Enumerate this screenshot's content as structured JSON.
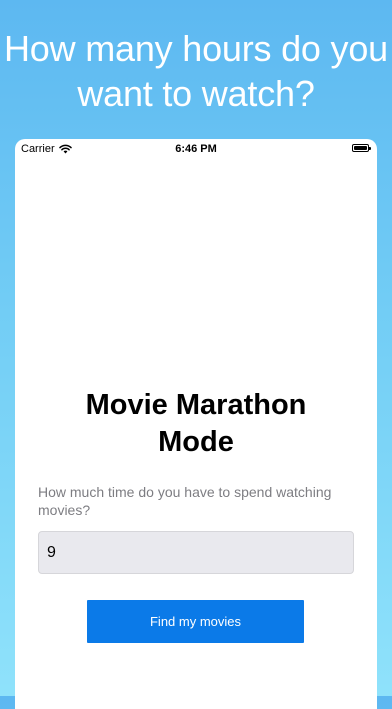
{
  "promo": {
    "headline_line1": "How many hours do you",
    "headline_line2": "want to watch?"
  },
  "status_bar": {
    "carrier": "Carrier",
    "time": "6:46 PM",
    "icons": [
      "wifi-icon",
      "battery-icon"
    ]
  },
  "main": {
    "title_line1": "Movie Marathon",
    "title_line2": "Mode",
    "question": "How much time do you have to spend watching movies?",
    "hours_value": "9",
    "find_button_label": "Find my movies"
  },
  "colors": {
    "background_gradient_top": "#5db8f1",
    "background_gradient_bottom": "#8fe2fb",
    "button_blue": "#0b7ae8",
    "input_background": "#e9e9ee"
  }
}
